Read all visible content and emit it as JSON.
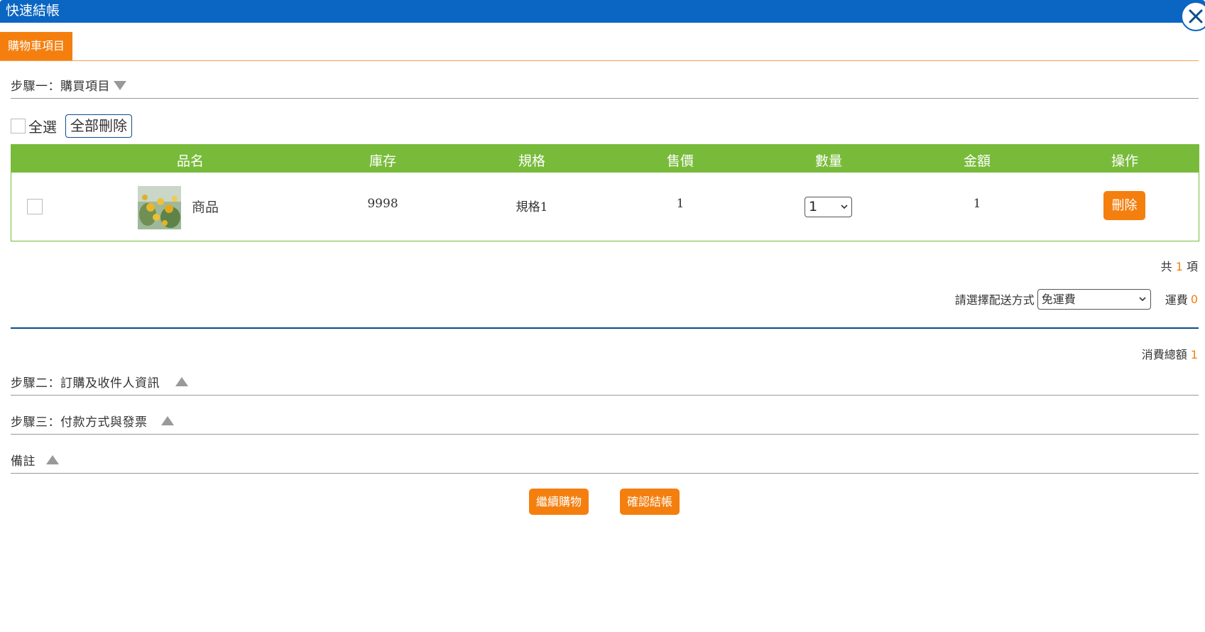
{
  "window": {
    "title": "快速結帳"
  },
  "tabs": [
    {
      "label": "購物車項目"
    }
  ],
  "step1": {
    "label": "步驟一：購買項目"
  },
  "select_all": {
    "label": "全選",
    "delete_all_label": "全部刪除"
  },
  "table": {
    "headers": [
      "品名",
      "庫存",
      "規格",
      "售價",
      "數量",
      "金額",
      "操作"
    ],
    "rows": [
      {
        "name": "商品",
        "stock": "9998",
        "spec": "規格1",
        "price": "1",
        "qty": "1",
        "amount": "1",
        "action_label": "刪除"
      }
    ]
  },
  "summary": {
    "count_prefix": "共",
    "count_value": "1",
    "count_suffix": "項",
    "shipping_label": "請選擇配送方式",
    "shipping_selected": "免運費",
    "shipping_fee_label": "運費",
    "shipping_fee_value": "0",
    "total_label": "消費總額",
    "total_value": "1"
  },
  "steps": [
    {
      "label": "步驟二：訂購及收件人資訊"
    },
    {
      "label": "步驟三：付款方式與發票"
    },
    {
      "label": "備註"
    }
  ],
  "buttons": {
    "continue_label": "繼續購物",
    "checkout_label": "確認結帳"
  },
  "colors": {
    "titlebar": "#0a66c2",
    "accent": "#f47f0f",
    "table_header": "#78bb3a"
  }
}
